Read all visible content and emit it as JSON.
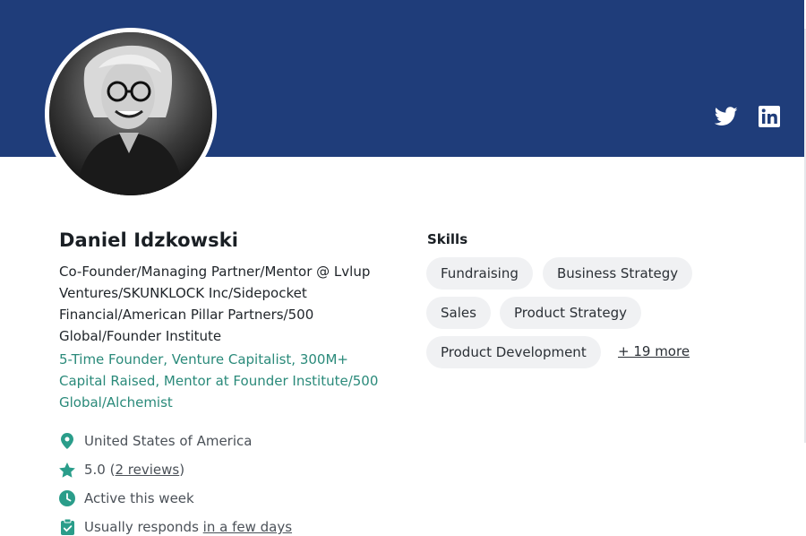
{
  "profile": {
    "name": "Daniel Idzkowski",
    "headline": "Co-Founder/Managing Partner/Mentor @ Lvlup Ventures/SKUNKLOCK Inc/Sidepocket Financial/American Pillar Partners/500 Global/Founder Institute",
    "tagline": "5-Time Founder, Venture Capitalist, 300M+ Capital Raised, Mentor at Founder Institute/500 Global/Alchemist",
    "location": "United States of America",
    "rating": "5.0",
    "reviews_open": "(",
    "reviews_link": "2 reviews",
    "reviews_close": ")",
    "activity": "Active this week",
    "responds_prefix": "Usually responds ",
    "responds_link": "in a few days"
  },
  "social": {
    "twitter_icon": "twitter-icon",
    "linkedin_icon": "linkedin-icon"
  },
  "skills": {
    "title": "Skills",
    "chips": [
      "Fundraising",
      "Business Strategy",
      "Sales",
      "Product Strategy",
      "Product Development"
    ],
    "more": "+ 19 more"
  },
  "colors": {
    "banner": "#1f3d7a",
    "accent": "#2a8a7a",
    "chip_bg": "#f0f1f3"
  }
}
